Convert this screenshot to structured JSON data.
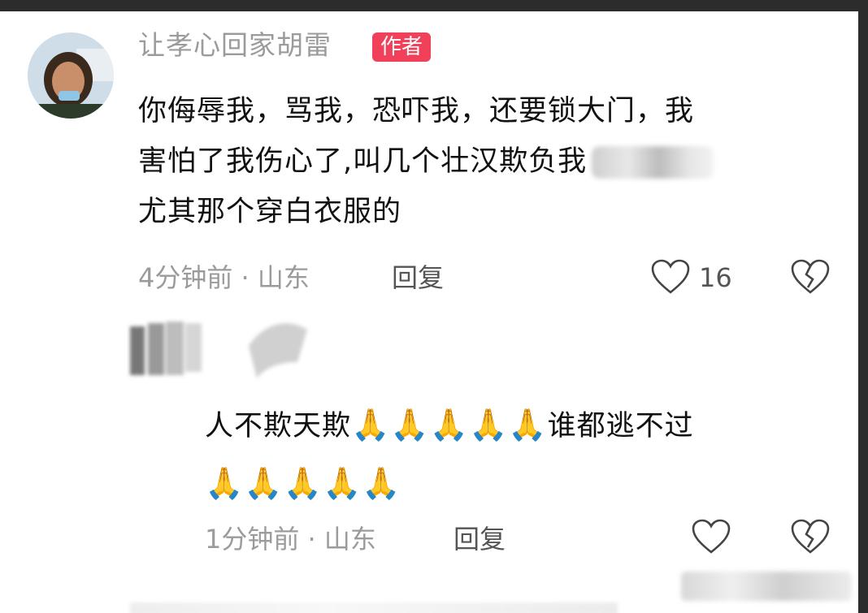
{
  "comment": {
    "username": "让孝心回家胡雷",
    "badge": "作者",
    "lines": [
      "你侮辱我，骂我，恐吓我，还要锁大门，我",
      "害怕了我伤心了,叫几个壮汉欺负我",
      "尤其那个穿白衣服的"
    ],
    "time_location": "4分钟前 · 山东",
    "reply_label": "回复",
    "like_count": "16",
    "icons": [
      "like-heart-icon",
      "dislike-broken-heart-icon"
    ]
  },
  "reply": {
    "line1_text": "人不欺天欺",
    "line1_emojis": "🙏🙏🙏🙏🙏",
    "line1_tail": "谁都逃不过",
    "line2_emojis": "🙏🙏🙏🙏🙏",
    "time_location": "1分钟前 · 山东",
    "reply_label": "回复",
    "icons": [
      "like-heart-icon",
      "dislike-broken-heart-icon"
    ]
  },
  "colors": {
    "badge": "#f0405a",
    "meta_text": "#9b9b9b",
    "body_text": "#111111",
    "frame": "#2c2c2c"
  }
}
